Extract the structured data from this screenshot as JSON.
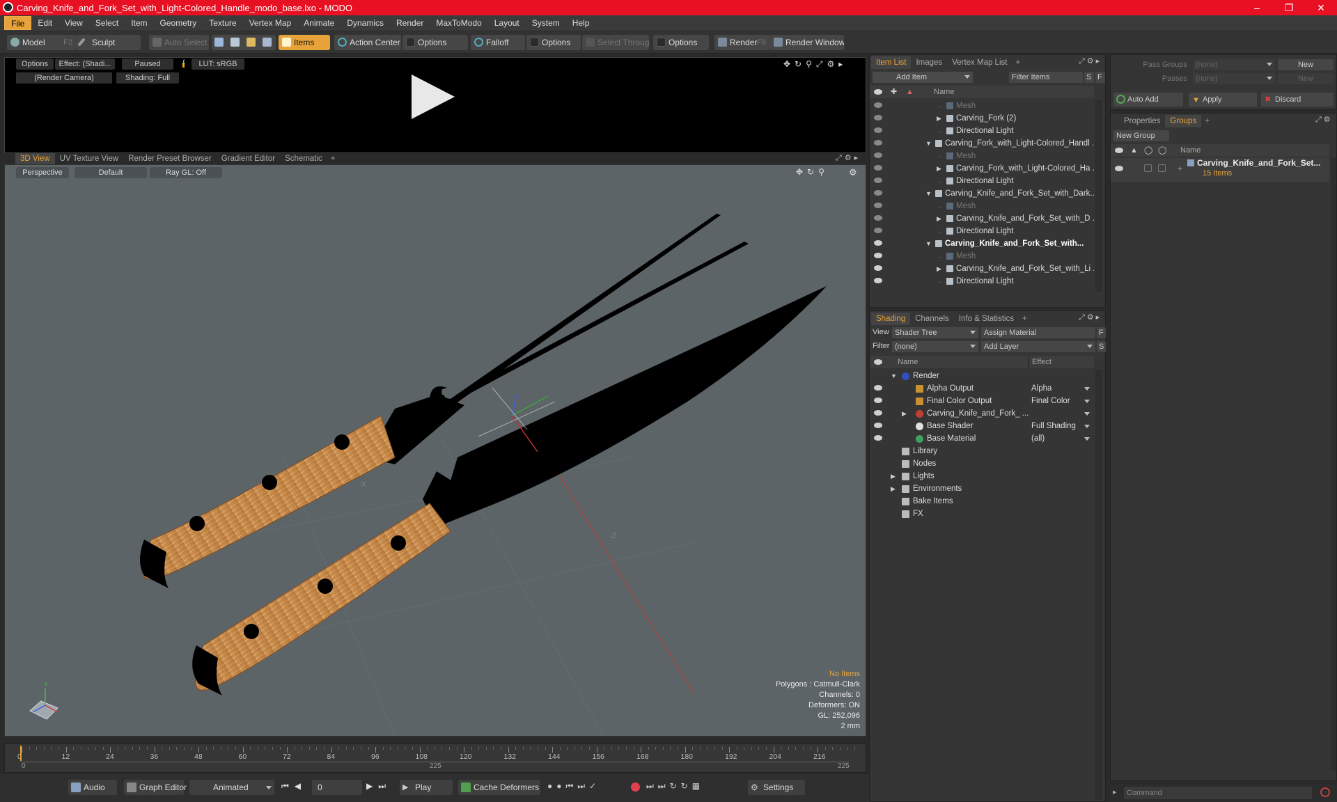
{
  "window": {
    "title": "Carving_Knife_and_Fork_Set_with_Light-Colored_Handle_modo_base.lxo - MODO"
  },
  "menu": [
    "File",
    "Edit",
    "View",
    "Select",
    "Item",
    "Geometry",
    "Texture",
    "Vertex Map",
    "Animate",
    "Dynamics",
    "Render",
    "MaxToModo",
    "Layout",
    "System",
    "Help"
  ],
  "toolbar": {
    "model": "Model",
    "model_key": "F2",
    "sculpt": "Sculpt",
    "auto_select": "Auto Select",
    "items": "Items",
    "action_center": "Action Center",
    "options1": "Options",
    "falloff": "Falloff",
    "options2": "Options",
    "select_through": "Select Through",
    "options3": "Options",
    "render": "Render",
    "render_key": "F9",
    "render_window": "Render Window"
  },
  "render_preview": {
    "options": "Options",
    "effect": "Effect: (Shadi...",
    "paused": "Paused",
    "lut": "LUT: sRGB",
    "camera": "(Render Camera)",
    "shading": "Shading: Full"
  },
  "viewport_tabs": [
    "3D View",
    "UV Texture View",
    "Render Preset Browser",
    "Gradient Editor",
    "Schematic",
    "+"
  ],
  "viewport": {
    "perspective": "Perspective",
    "default": "Default",
    "raygl": "Ray GL: Off",
    "stats": {
      "no_items": "No Items",
      "polygons": "Polygons : Catmull-Clark",
      "channels": "Channels: 0",
      "deformers": "Deformers: ON",
      "gl": "GL: 252,096",
      "scale": "2 mm"
    },
    "axis_x": "-X",
    "axis_z": "-Z",
    "axis_y": "Y"
  },
  "timeline": {
    "ticks": [
      "0",
      "12",
      "24",
      "36",
      "48",
      "60",
      "72",
      "84",
      "96",
      "108",
      "120",
      "132",
      "144",
      "156",
      "168",
      "180",
      "192",
      "204",
      "216"
    ],
    "start": "0",
    "mid": "225",
    "end": "225"
  },
  "bottom": {
    "audio": "Audio",
    "graph_editor": "Graph Editor",
    "animated": "Animated",
    "frame": "0",
    "play": "Play",
    "cache": "Cache Deformers",
    "settings": "Settings"
  },
  "item_list": {
    "tabs": [
      "Item List",
      "Images",
      "Vertex Map List",
      "+"
    ],
    "add_item": "Add Item",
    "filter": "Filter Items",
    "s": "S",
    "f": "F",
    "col_name": "Name",
    "rows": [
      {
        "label": "Mesh",
        "indent": 2,
        "dim": true,
        "bold": false,
        "expand": false
      },
      {
        "label": "Carving_Fork (2)",
        "indent": 2,
        "dim": false,
        "bold": false,
        "expand": true
      },
      {
        "label": "Directional Light",
        "indent": 2,
        "dim": false,
        "bold": false,
        "expand": false
      },
      {
        "label": "Carving_Fork_with_Light-Colored_Handl ...",
        "indent": 1,
        "dim": false,
        "bold": false,
        "expand": "open"
      },
      {
        "label": "Mesh",
        "indent": 2,
        "dim": true,
        "bold": false,
        "expand": false
      },
      {
        "label": "Carving_Fork_with_Light-Colored_Ha ...",
        "indent": 2,
        "dim": false,
        "bold": false,
        "expand": true
      },
      {
        "label": "Directional Light",
        "indent": 2,
        "dim": false,
        "bold": false,
        "expand": false
      },
      {
        "label": "Carving_Knife_and_Fork_Set_with_Dark...",
        "indent": 1,
        "dim": false,
        "bold": false,
        "expand": "open"
      },
      {
        "label": "Mesh",
        "indent": 2,
        "dim": true,
        "bold": false,
        "expand": false
      },
      {
        "label": "Carving_Knife_and_Fork_Set_with_D ...",
        "indent": 2,
        "dim": false,
        "bold": false,
        "expand": true
      },
      {
        "label": "Directional Light",
        "indent": 2,
        "dim": false,
        "bold": false,
        "expand": false
      },
      {
        "label": "Carving_Knife_and_Fork_Set_with...",
        "indent": 1,
        "dim": false,
        "bold": true,
        "expand": "open"
      },
      {
        "label": "Mesh",
        "indent": 2,
        "dim": true,
        "bold": false,
        "expand": false
      },
      {
        "label": "Carving_Knife_and_Fork_Set_with_Li ...",
        "indent": 2,
        "dim": false,
        "bold": false,
        "expand": true
      },
      {
        "label": "Directional Light",
        "indent": 2,
        "dim": false,
        "bold": false,
        "expand": false
      }
    ]
  },
  "shading": {
    "tabs": [
      "Shading",
      "Channels",
      "Info & Statistics",
      "+"
    ],
    "view_label": "View",
    "view_value": "Shader Tree",
    "assign": "Assign Material",
    "f": "F",
    "filter_label": "Filter",
    "filter_value": "(none)",
    "add_layer": "Add Layer",
    "s": "S",
    "col_name": "Name",
    "col_effect": "Effect",
    "rows": [
      {
        "label": "Render",
        "effect": "",
        "indent": 0,
        "eye": false
      },
      {
        "label": "Alpha Output",
        "effect": "Alpha",
        "indent": 1,
        "eye": true
      },
      {
        "label": "Final Color Output",
        "effect": "Final Color",
        "indent": 1,
        "eye": true
      },
      {
        "label": "Carving_Knife_and_Fork_ ...",
        "effect": "",
        "indent": 1,
        "eye": true
      },
      {
        "label": "Base Shader",
        "effect": "Full Shading",
        "indent": 1,
        "eye": true
      },
      {
        "label": "Base Material",
        "effect": "(all)",
        "indent": 1,
        "eye": true
      },
      {
        "label": "Library",
        "effect": "",
        "indent": 0,
        "eye": false
      },
      {
        "label": "Nodes",
        "effect": "",
        "indent": 0,
        "eye": false
      },
      {
        "label": "Lights",
        "effect": "",
        "indent": 0,
        "eye": false
      },
      {
        "label": "Environments",
        "effect": "",
        "indent": 0,
        "eye": false
      },
      {
        "label": "Bake Items",
        "effect": "",
        "indent": 0,
        "eye": false
      },
      {
        "label": "FX",
        "effect": "",
        "indent": 0,
        "eye": false
      }
    ]
  },
  "right": {
    "pass_groups": "Pass Groups",
    "pass_groups_value": "(none)",
    "new": "New",
    "passes": "Passes",
    "passes_value": "(none)",
    "new2": "New",
    "auto_add": "Auto Add",
    "apply": "Apply",
    "discard": "Discard",
    "tabs": [
      "Properties",
      "Groups",
      "+"
    ],
    "new_group": "New Group",
    "col_name": "Name",
    "group_name": "Carving_Knife_and_Fork_Set...",
    "group_count": "15 Items",
    "command": "Command"
  },
  "colors": {
    "accent": "#e8a23a",
    "title_bar": "#e81123"
  }
}
